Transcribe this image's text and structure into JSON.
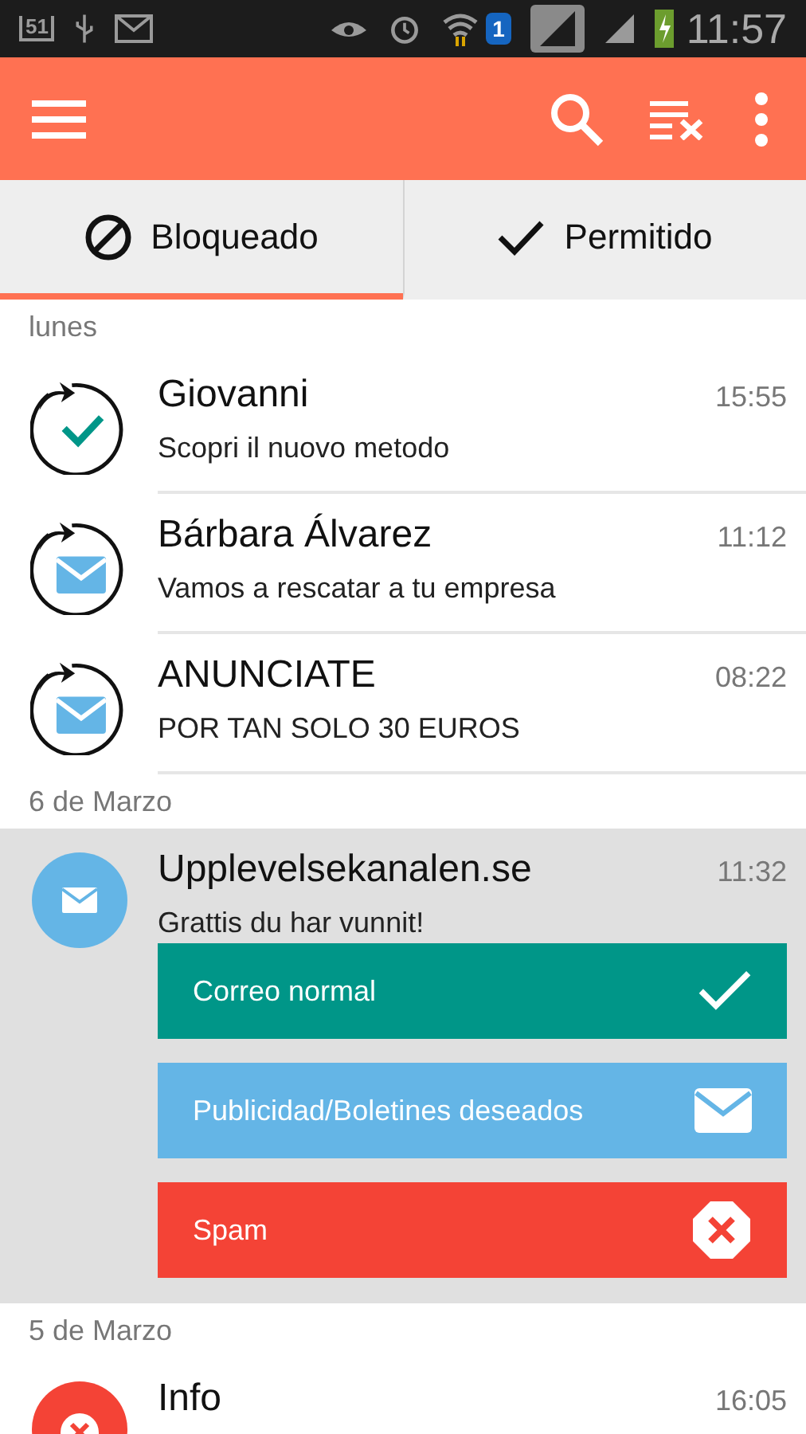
{
  "status_bar": {
    "notification_count": "51",
    "sim": "1",
    "time": "11:57"
  },
  "tabs": [
    {
      "label": "Bloqueado",
      "kind": "blocked",
      "selected": true
    },
    {
      "label": "Permitido",
      "kind": "allowed",
      "selected": false
    }
  ],
  "sections": [
    {
      "date": "lunes",
      "messages": [
        {
          "sender": "Giovanni",
          "preview": "Scopri il nuovo metodo",
          "time": "15:55",
          "kind": "resent-check",
          "expanded": false
        },
        {
          "sender": "Bárbara Álvarez",
          "preview": "Vamos a rescatar a tu empresa",
          "time": "11:12",
          "kind": "resent-mail",
          "expanded": false
        },
        {
          "sender": "ANUNCIATE",
          "preview": "POR TAN SOLO 30 EUROS",
          "time": "08:22",
          "kind": "resent-mail",
          "expanded": false
        }
      ]
    },
    {
      "date": "6 de Marzo",
      "messages": [
        {
          "sender": "Upplevelsekanalen.se",
          "preview": "Grattis du har vunnit!",
          "time": "11:32",
          "kind": "mail",
          "expanded": true,
          "options": [
            {
              "label": "Correo normal",
              "kind": "normal",
              "color": "#009688"
            },
            {
              "label": "Publicidad/Boletines deseados",
              "kind": "wanted",
              "color": "#64b5e6"
            },
            {
              "label": "Spam",
              "kind": "spam",
              "color": "#f44336"
            }
          ]
        }
      ]
    },
    {
      "date": "5 de Marzo",
      "messages": [
        {
          "sender": "Info",
          "time": "16:05",
          "kind": "spam",
          "expanded": false
        }
      ]
    }
  ]
}
